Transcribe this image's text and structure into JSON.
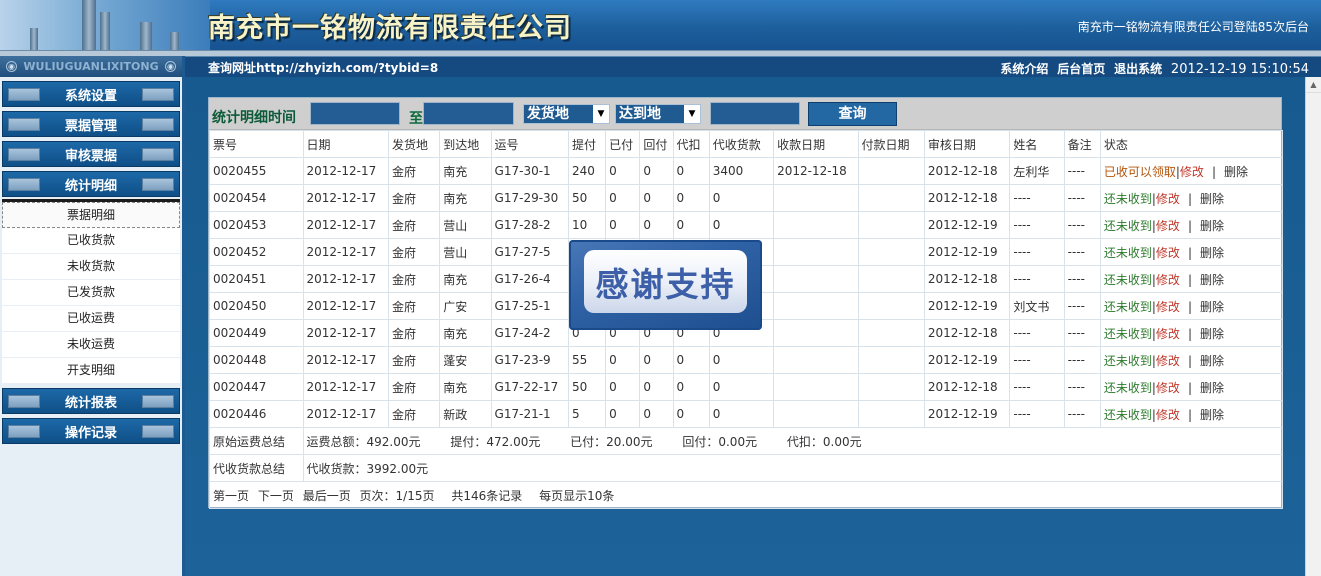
{
  "header": {
    "company": "南充市一铭物流有限责任公司",
    "login_info": "南充市一铭物流有限责任公司登陆85次后台",
    "sidebar_brand": "WULIUGUANLIXITONG"
  },
  "nav": {
    "query_url": "查询网址http://zhyizh.com/?tybid=8",
    "links": [
      "系统介绍",
      "后台首页",
      "退出系统"
    ],
    "datetime": "2012-12-19 15:10:54"
  },
  "sidebar": {
    "sections": [
      "系统设置",
      "票据管理",
      "审核票据",
      "统计明细"
    ],
    "sub_items": [
      "票据明细",
      "已收货款",
      "未收货款",
      "已发货款",
      "已收运费",
      "未收运费",
      "开支明细"
    ],
    "bottom_sections": [
      "统计报表",
      "操作记录"
    ]
  },
  "filter": {
    "label": "统计明细时间",
    "to": "至",
    "from_select": "发货地",
    "to_select": "达到地",
    "query_button": "查询"
  },
  "table": {
    "headers": [
      "票号",
      "日期",
      "发货地",
      "到达地",
      "运号",
      "提付",
      "已付",
      "回付",
      "代扣",
      "代收货款",
      "收款日期",
      "付款日期",
      "审核日期",
      "姓名",
      "备注",
      "状态"
    ],
    "rows": [
      [
        "0020455",
        "2012-12-17",
        "金府",
        "南充",
        "G17-30-1",
        "240",
        "0",
        "0",
        "0",
        "3400",
        "2012-12-18",
        "",
        "2012-12-18",
        "左利华",
        "----",
        "已收可以领取"
      ],
      [
        "0020454",
        "2012-12-17",
        "金府",
        "南充",
        "G17-29-30",
        "50",
        "0",
        "0",
        "0",
        "0",
        "",
        "",
        "2012-12-18",
        "----",
        "----",
        "还未收到"
      ],
      [
        "0020453",
        "2012-12-17",
        "金府",
        "营山",
        "G17-28-2",
        "10",
        "0",
        "0",
        "0",
        "0",
        "",
        "",
        "2012-12-19",
        "----",
        "----",
        "还未收到"
      ],
      [
        "0020452",
        "2012-12-17",
        "金府",
        "营山",
        "G17-27-5",
        "",
        "",
        "",
        "",
        "",
        "",
        "",
        "2012-12-19",
        "----",
        "----",
        "还未收到"
      ],
      [
        "0020451",
        "2012-12-17",
        "金府",
        "南充",
        "G17-26-4",
        "",
        "",
        "",
        "",
        "",
        "",
        "",
        "2012-12-18",
        "----",
        "----",
        "还未收到"
      ],
      [
        "0020450",
        "2012-12-17",
        "金府",
        "广安",
        "G17-25-1",
        "",
        "",
        "",
        "",
        "",
        "",
        "",
        "2012-12-19",
        "刘文书",
        "----",
        "还未收到"
      ],
      [
        "0020449",
        "2012-12-17",
        "金府",
        "南充",
        "G17-24-2",
        "0",
        "0",
        "0",
        "0",
        "0",
        "",
        "",
        "2012-12-18",
        "----",
        "----",
        "还未收到"
      ],
      [
        "0020448",
        "2012-12-17",
        "金府",
        "蓬安",
        "G17-23-9",
        "55",
        "0",
        "0",
        "0",
        "0",
        "",
        "",
        "2012-12-19",
        "----",
        "----",
        "还未收到"
      ],
      [
        "0020447",
        "2012-12-17",
        "金府",
        "南充",
        "G17-22-17",
        "50",
        "0",
        "0",
        "0",
        "0",
        "",
        "",
        "2012-12-18",
        "----",
        "----",
        "还未收到"
      ],
      [
        "0020446",
        "2012-12-17",
        "金府",
        "新政",
        "G17-21-1",
        "5",
        "0",
        "0",
        "0",
        "0",
        "",
        "",
        "2012-12-19",
        "----",
        "----",
        "还未收到"
      ]
    ],
    "edit_label": "修改",
    "delete_label": "删除",
    "sep": "|"
  },
  "summary": {
    "freight_label": "原始运费总结",
    "freight_parts": [
      "运费总额：492.00元",
      "提付：472.00元",
      "已付：20.00元",
      "回付：0.00元",
      "代扣：0.00元"
    ],
    "cod_label": "代收货款总结",
    "cod_value": "代收货款：3992.00元"
  },
  "pager": {
    "first": "第一页",
    "next": "下一页",
    "last": "最后一页",
    "page_label": "页次：",
    "page_value": "1/15页",
    "records": "共146条记录",
    "per_page": "每页显示10条"
  },
  "overlay": {
    "text": "感谢支持"
  }
}
